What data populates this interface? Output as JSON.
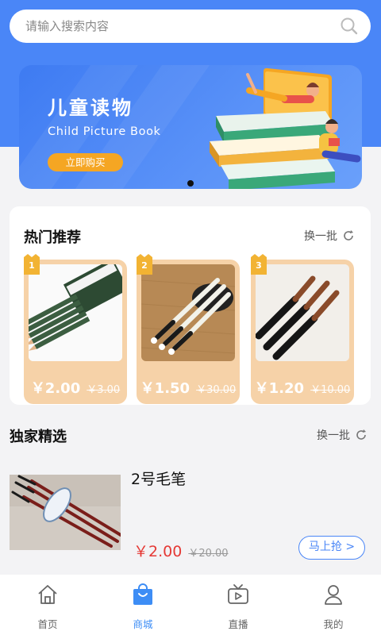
{
  "search": {
    "placeholder": "请输入搜索内容",
    "icon": "search-icon"
  },
  "banner": {
    "title": "儿童读物",
    "subtitle": "Child Picture Book",
    "button_label": "立即购买"
  },
  "hot": {
    "title": "热门推荐",
    "refresh_label": "换一批",
    "items": [
      {
        "rank": "1",
        "image": "pencils",
        "price": "￥2.00",
        "original_price": "￥3.00"
      },
      {
        "rank": "2",
        "image": "calligraphy-brushes",
        "price": "￥1.50",
        "original_price": "￥30.00"
      },
      {
        "rank": "3",
        "image": "wolf-hair-brushes",
        "price": "￥1.20",
        "original_price": "￥10.00"
      }
    ]
  },
  "exclusive": {
    "title": "独家精选",
    "refresh_label": "换一批",
    "item": {
      "name": "2号毛笔",
      "price": "￥2.00",
      "original_price": "￥20.00",
      "buy_label": "马上抢 >"
    }
  },
  "tabbar": {
    "active_color": "#3d8df5",
    "items": [
      {
        "label": "首页",
        "icon": "home-icon"
      },
      {
        "label": "商城",
        "icon": "shopping-bag-icon",
        "active": true
      },
      {
        "label": "直播",
        "icon": "live-tv-icon"
      },
      {
        "label": "我的",
        "icon": "user-icon"
      }
    ]
  }
}
